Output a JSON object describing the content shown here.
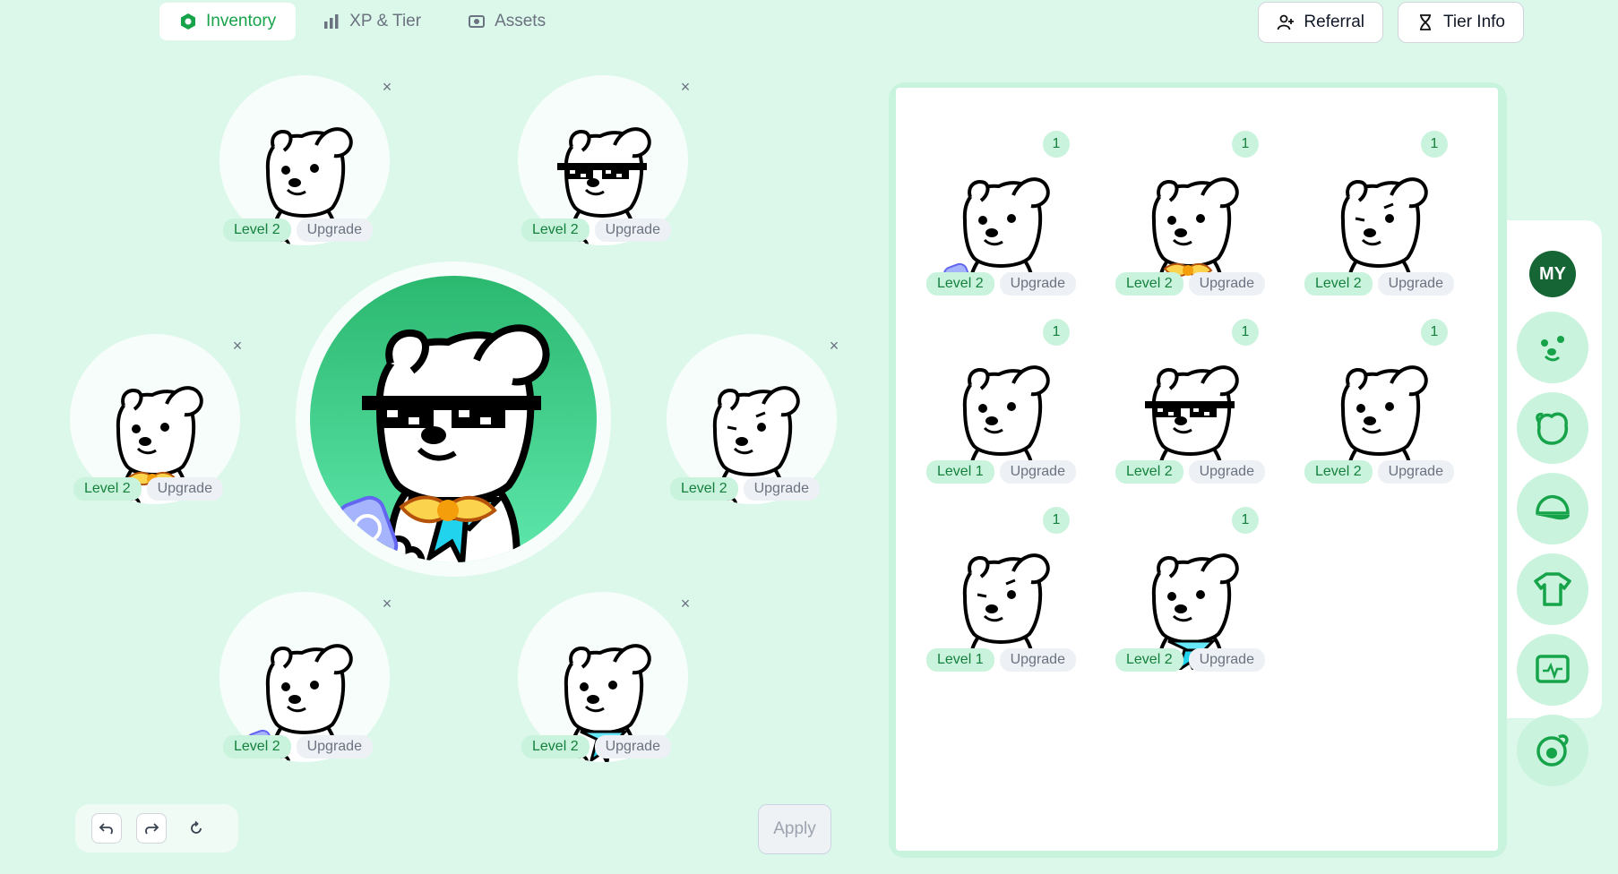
{
  "nav": {
    "tabs": [
      {
        "label": "Inventory",
        "icon": "hexagon-icon",
        "active": true
      },
      {
        "label": "XP & Tier",
        "icon": "bar-chart-icon",
        "active": false
      },
      {
        "label": "Assets",
        "icon": "assets-icon",
        "active": false
      }
    ],
    "referral_label": "Referral",
    "tier_info_label": "Tier Info"
  },
  "arrangement": {
    "slots": [
      {
        "level": "Level 2",
        "upgrade": "Upgrade",
        "remove": "×",
        "accessory": "none"
      },
      {
        "level": "Level 2",
        "upgrade": "Upgrade",
        "remove": "×",
        "accessory": "pixel-sunglasses"
      },
      {
        "level": "Level 2",
        "upgrade": "Upgrade",
        "remove": "×",
        "accessory": "gold-badge"
      },
      {
        "level": "Level 2",
        "upgrade": "Upgrade",
        "remove": "×",
        "accessory": "wink"
      },
      {
        "level": "Level 2",
        "upgrade": "Upgrade",
        "remove": "×",
        "accessory": "blue-can"
      },
      {
        "level": "Level 2",
        "upgrade": "Upgrade",
        "remove": "×",
        "accessory": "sailor-scarf"
      }
    ],
    "apply_label": "Apply"
  },
  "inventory": {
    "items": [
      {
        "count": "1",
        "level": "Level 2",
        "upgrade": "Upgrade",
        "accessory": "blue-can"
      },
      {
        "count": "1",
        "level": "Level 2",
        "upgrade": "Upgrade",
        "accessory": "gold-badge"
      },
      {
        "count": "1",
        "level": "Level 2",
        "upgrade": "Upgrade",
        "accessory": "wink"
      },
      {
        "count": "1",
        "level": "Level 1",
        "upgrade": "Upgrade",
        "accessory": "none"
      },
      {
        "count": "1",
        "level": "Level 2",
        "upgrade": "Upgrade",
        "accessory": "pixel-sunglasses"
      },
      {
        "count": "1",
        "level": "Level 2",
        "upgrade": "Upgrade",
        "accessory": "none"
      },
      {
        "count": "1",
        "level": "Level 1",
        "upgrade": "Upgrade",
        "accessory": "wink"
      },
      {
        "count": "1",
        "level": "Level 2",
        "upgrade": "Upgrade",
        "accessory": "sailor-scarf"
      }
    ]
  },
  "categories": {
    "my_label": "MY",
    "items": [
      "face-icon",
      "head-icon",
      "cap-icon",
      "shirt-icon",
      "screen-icon",
      "hand-item-icon"
    ]
  },
  "colors": {
    "background": "#dcf8eb",
    "accent": "#16a34a",
    "dark_accent": "#166534",
    "level_pill": "#c9f3dc",
    "main_gradient_top": "#2bb86f",
    "main_gradient_bottom": "#5ee7ac"
  }
}
